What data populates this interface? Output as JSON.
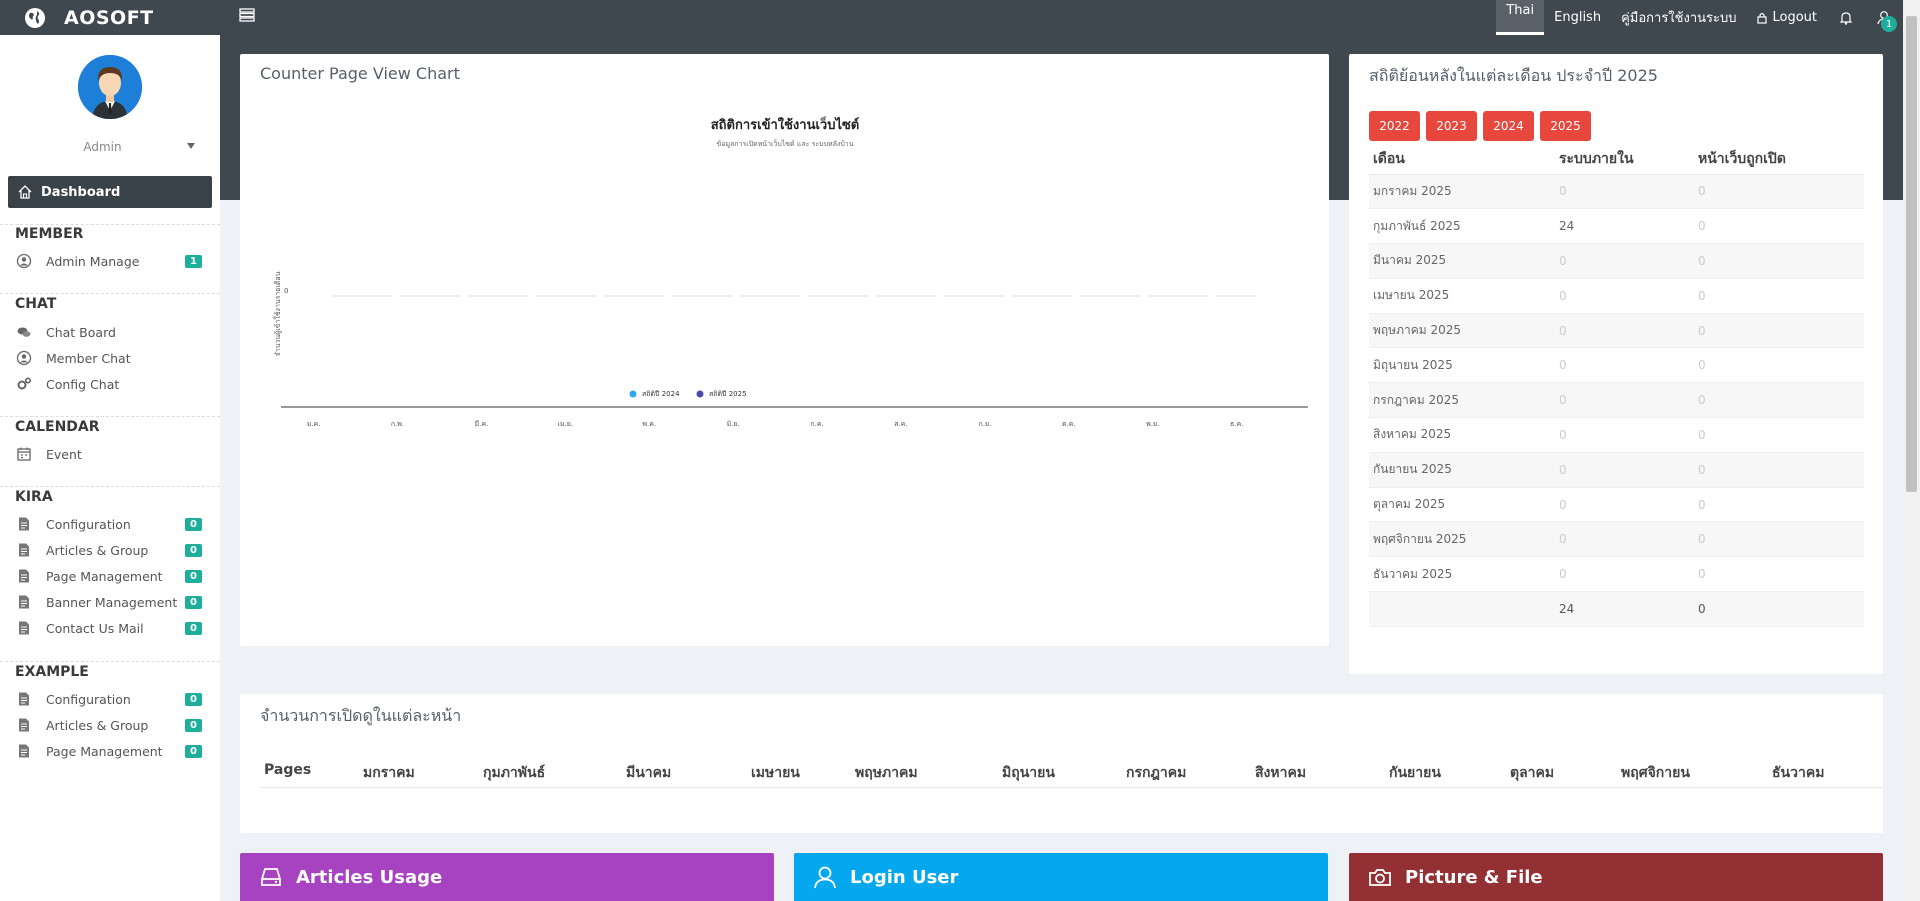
{
  "brand": {
    "name": "AOSOFT"
  },
  "topnav": {
    "thai": "Thai",
    "english": "English",
    "manual": "คู่มือการใช้งานระบบ",
    "logout": "Logout",
    "user_badge": "1"
  },
  "sidebar": {
    "admin_name": "Admin",
    "dashboard": "Dashboard",
    "sections": {
      "member": "MEMBER",
      "chat": "CHAT",
      "calendar": "CALENDAR",
      "kira": "KIRA",
      "example": "EXAMPLE"
    },
    "items": {
      "admin_manage": {
        "label": "Admin Manage",
        "count": "1"
      },
      "chat_board": {
        "label": "Chat Board"
      },
      "member_chat": {
        "label": "Member Chat"
      },
      "config_chat": {
        "label": "Config Chat"
      },
      "event": {
        "label": "Event"
      },
      "kira_configuration": {
        "label": "Configuration",
        "count": "0"
      },
      "kira_articles": {
        "label": "Articles & Group",
        "count": "0"
      },
      "kira_pages": {
        "label": "Page Management",
        "count": "0"
      },
      "kira_banner": {
        "label": "Banner Management",
        "count": "0"
      },
      "kira_contact": {
        "label": "Contact Us Mail",
        "count": "0"
      },
      "ex_configuration": {
        "label": "Configuration",
        "count": "0"
      },
      "ex_articles": {
        "label": "Articles & Group",
        "count": "0"
      },
      "ex_pages": {
        "label": "Page Management",
        "count": "0"
      }
    }
  },
  "chart_card": {
    "title": "Counter Page View Chart"
  },
  "chart_data": {
    "type": "line",
    "title": "สถิติการเข้าใช้งานเว็บไซต์",
    "subtitle": "ข้อมูลการเปิดหน้าเว็บไซต์ และ ระบบหลังบ้าน",
    "ylabel": "จำนวนผู้เข้าใช้งานรายเดือน",
    "xlabel": "",
    "categories": [
      "ม.ค.",
      "ก.พ.",
      "มี.ค.",
      "เม.ย.",
      "พ.ค.",
      "มิ.ย.",
      "ก.ค.",
      "ส.ค.",
      "ก.ย.",
      "ต.ค.",
      "พ.ย.",
      "ธ.ค."
    ],
    "y_ticks": [
      "0"
    ],
    "legend_position": "bottom",
    "series": [
      {
        "name": "สถิติปี 2024",
        "color": "#2ea7f0",
        "values": [
          0,
          0,
          0,
          0,
          0,
          0,
          0,
          0,
          0,
          0,
          0,
          0
        ]
      },
      {
        "name": "สถิติปี 2025",
        "color": "#4a4aa8",
        "values": [
          0,
          0,
          0,
          0,
          0,
          0,
          0,
          0,
          0,
          0,
          0,
          0
        ]
      }
    ]
  },
  "stats": {
    "title": "สถิติย้อนหลังในแต่ละเดือน ประจำปี 2025",
    "years": [
      "2022",
      "2023",
      "2024",
      "2025"
    ],
    "columns": [
      "เดือน",
      "ระบบภายใน",
      "หน้าเว็บถูกเปิด"
    ],
    "rows": [
      [
        "มกราคม 2025",
        "0",
        "0"
      ],
      [
        "กุมภาพันธ์ 2025",
        "24",
        "0"
      ],
      [
        "มีนาคม 2025",
        "0",
        "0"
      ],
      [
        "เมษายน 2025",
        "0",
        "0"
      ],
      [
        "พฤษภาคม 2025",
        "0",
        "0"
      ],
      [
        "มิถุนายน 2025",
        "0",
        "0"
      ],
      [
        "กรกฎาคม 2025",
        "0",
        "0"
      ],
      [
        "สิงหาคม 2025",
        "0",
        "0"
      ],
      [
        "กันยายน 2025",
        "0",
        "0"
      ],
      [
        "ตุลาคม 2025",
        "0",
        "0"
      ],
      [
        "พฤศจิกายน 2025",
        "0",
        "0"
      ],
      [
        "ธันวาคม 2025",
        "0",
        "0"
      ]
    ],
    "total": [
      "",
      "24",
      "0"
    ]
  },
  "pages_card": {
    "title": "จำนวนการเปิดดูในแต่ละหน้า",
    "columns": [
      "Pages",
      "มกราคม",
      "กุมภาพันธ์",
      "มีนาคม",
      "เมษายน",
      "พฤษภาคม",
      "มิถุนายน",
      "กรกฎาคม",
      "สิงหาคม",
      "กันยายน",
      "ตุลาคม",
      "พฤศจิกายน",
      "ธันวาคม"
    ]
  },
  "tiles": {
    "articles": {
      "label": "Articles Usage",
      "color": "#a742c0"
    },
    "login": {
      "label": "Login User",
      "color": "#05a8ef"
    },
    "picture": {
      "label": "Picture & File",
      "color": "#923034"
    }
  }
}
